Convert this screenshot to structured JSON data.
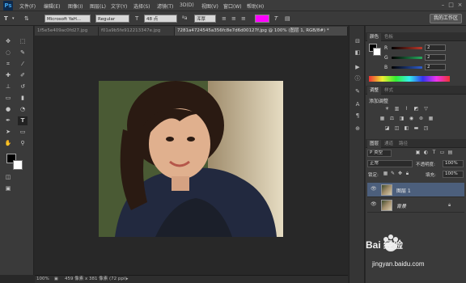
{
  "app": {
    "logo": "Ps"
  },
  "menu": [
    "文件(F)",
    "编辑(E)",
    "图像(I)",
    "图层(L)",
    "文字(Y)",
    "选择(S)",
    "滤镜(T)",
    "3D(D)",
    "视图(V)",
    "窗口(W)",
    "帮助(H)"
  ],
  "window_controls": [
    "–",
    "□",
    "×"
  ],
  "options": {
    "font_family": "Microsoft YaH...",
    "font_style": "Regular",
    "font_size": "48 点",
    "antialias": "浑厚",
    "workspace": "我的工作区"
  },
  "tabs": [
    {
      "label": "1f5e5e409ac0fd27.jpg"
    },
    {
      "label": "f01a9b5fe912213347e.jpg"
    },
    {
      "label": "7281a4724545a356fc8e7d6d00127f.jpg @ 100% (图层 1, RGB/8#) *"
    }
  ],
  "status": {
    "zoom": "100%",
    "doc_size": "459 像素 x 381 像素 (72 ppi)"
  },
  "color_panel": {
    "tabs": [
      "颜色",
      "色板"
    ],
    "channels": [
      {
        "label": "R",
        "value": "2",
        "color": "#c0392b"
      },
      {
        "label": "G",
        "value": "2",
        "color": "#27ae60"
      },
      {
        "label": "B",
        "value": "2",
        "color": "#2f5fd0"
      }
    ]
  },
  "adjust_panel": {
    "tabs": [
      "调整",
      "样式"
    ],
    "title": "添加调整"
  },
  "layers_panel": {
    "tabs": [
      "图层",
      "通道",
      "路径"
    ],
    "kind": "P 类型",
    "blend_mode": "正常",
    "opacity_label": "不透明度:",
    "opacity": "100%",
    "lock_label": "锁定:",
    "fill_label": "填充:",
    "fill": "100%",
    "layers": [
      {
        "name": "图层 1",
        "selected": true
      },
      {
        "name": "背景",
        "selected": false
      }
    ]
  },
  "watermark": {
    "brand": "Bai 经验",
    "url": "jingyan.baidu.com"
  }
}
